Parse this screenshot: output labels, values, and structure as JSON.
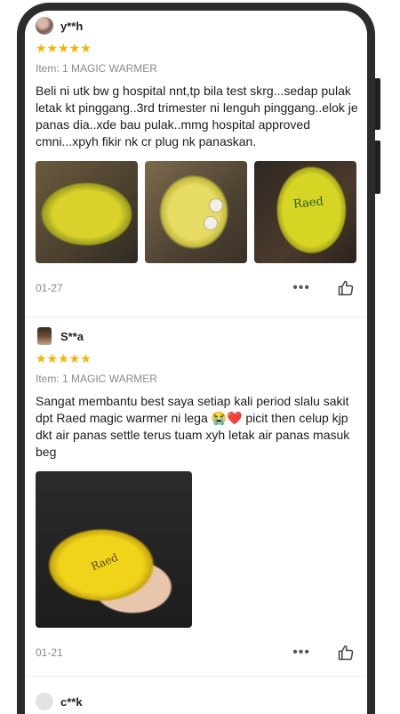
{
  "reviews": [
    {
      "username": "y**h",
      "stars": "★★★★★",
      "item": "Item: 1 MAGIC WARMER",
      "text": "Beli ni utk bw g hospital nnt,tp bila test skrg...sedap pulak letak kt pinggang..3rd trimester ni lenguh pinggang..elok je panas dia..xde bau pulak..mmg hospital approved cmni...xpyh fikir nk cr plug nk panaskan.",
      "photo_brand": "Raed",
      "date": "01-27",
      "more": "•••"
    },
    {
      "username": "S**a",
      "stars": "★★★★★",
      "item": "Item: 1 MAGIC WARMER",
      "text": "Sangat membantu best saya setiap kali period slalu sakit dpt Raed magic warmer ni lega 😭❤️ picit then celup kjp dkt air panas settle terus tuam xyh letak air panas masuk beg",
      "photo_brand": "Raed",
      "date": "01-21",
      "more": "•••"
    },
    {
      "username": "c**k"
    }
  ],
  "colors": {
    "star": "#f5b301",
    "frame": "#2c2c2e"
  },
  "icons": {
    "more": "more-options-icon",
    "like": "thumbs-up-icon"
  }
}
